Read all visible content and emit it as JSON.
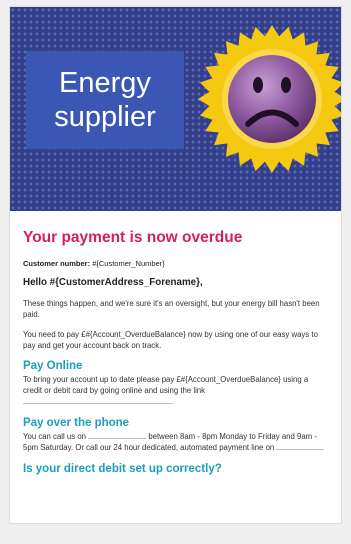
{
  "hero": {
    "label": "Energy\nsupplier",
    "icon": "sad-face-icon",
    "colors": {
      "background": "#333f88",
      "label_bg": "#3b57b3",
      "burst": "#f5c811",
      "face": "#8e5a9e"
    }
  },
  "email": {
    "headline": "Your payment is now overdue",
    "customer_number_label": "Customer number:",
    "customer_number_value": "#{Customer_Number}",
    "greeting": "Hello #{CustomerAddress_Forename},",
    "intro": "These things happen, and we're sure it's an oversight, but your energy bill hasn't been paid.",
    "pay_request": "You need to pay £#{Account_OverdueBalance} now by using one of our easy ways to pay and get your account back on track.",
    "sections": [
      {
        "title": "Pay Online",
        "text_start": "To bring your account up to date please pay £#{Account_OverdueBalance} using a credit or debit card by going online and using the link"
      },
      {
        "title": "Pay over the phone",
        "text_start": "You can call us on",
        "text_end": "between 8am - 8pm Monday to Friday and 9am - 5pm Saturday. Or call our 24 hour dedicated, automated payment line on"
      }
    ],
    "direct_debit": "Is your direct debit set up correctly?"
  },
  "colors": {
    "accent_pink": "#d6205c",
    "accent_teal": "#1a9fb8"
  }
}
